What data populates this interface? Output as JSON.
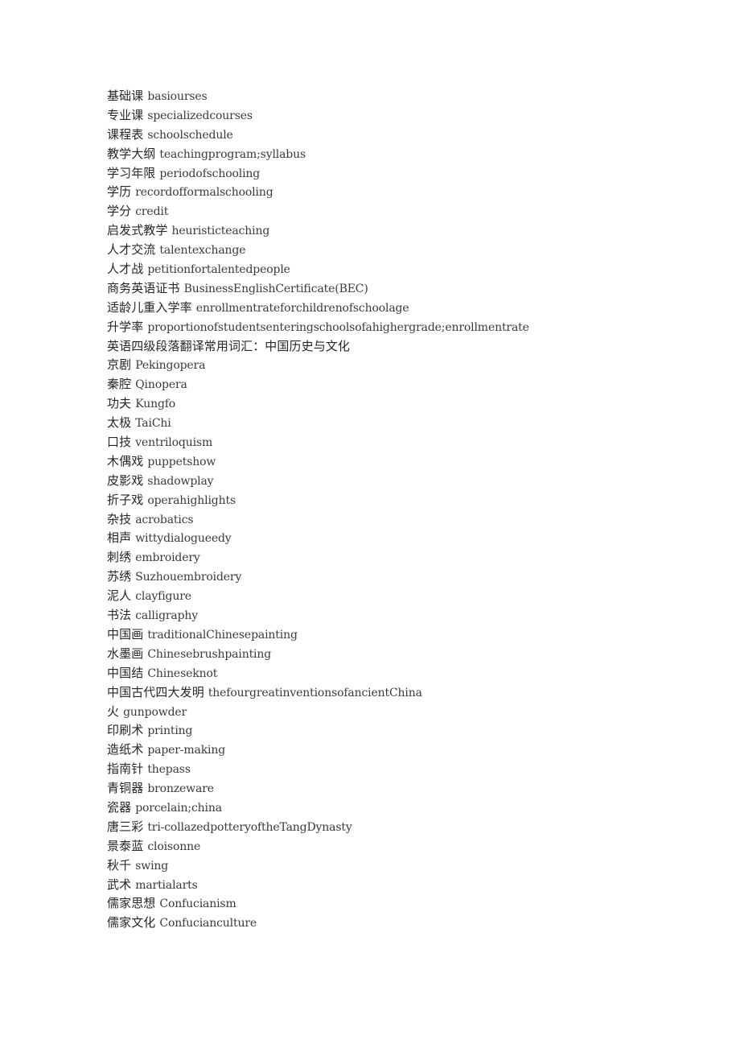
{
  "document": {
    "background_color": "#ffffff",
    "text_color": "#2b2b2b",
    "lines": [
      {
        "cn": "基础课",
        "en": "basiourses"
      },
      {
        "cn": "专业课",
        "en": "specializedcourses"
      },
      {
        "cn": "课程表",
        "en": "schoolschedule"
      },
      {
        "cn": "教学大纲",
        "en": "teachingprogram;syllabus"
      },
      {
        "cn": "学习年限",
        "en": "periodofschooling"
      },
      {
        "cn": "学历",
        "en": "recordofformalschooling"
      },
      {
        "cn": "学分",
        "en": "credit"
      },
      {
        "cn": "启发式教学",
        "en": "heuristicteaching"
      },
      {
        "cn": "人才交流",
        "en": "talentexchange"
      },
      {
        "cn": "人才战",
        "en": "petitionfortalentedpeople"
      },
      {
        "cn": "商务英语证书",
        "en": "BusinessEnglishCertificate(BEC)"
      },
      {
        "cn": "适龄儿重入学率",
        "en": "enrollmentrateforchildrenofschoolage"
      },
      {
        "cn": "升学率",
        "en": "proportionofstudentsenteringschoolsofahighergrade;enrollmentrate"
      },
      {
        "cn": "英语四级段落翻译常用词汇：中国历史与文化",
        "en": "",
        "heading": true
      },
      {
        "cn": "京剧",
        "en": "Pekingopera"
      },
      {
        "cn": "秦腔",
        "en": "Qinopera"
      },
      {
        "cn": "功夫",
        "en": "Kungfo"
      },
      {
        "cn": "太极",
        "en": "TaiChi"
      },
      {
        "cn": "口技",
        "en": "ventriloquism"
      },
      {
        "cn": "木偶戏",
        "en": "puppetshow"
      },
      {
        "cn": "皮影戏",
        "en": "shadowplay"
      },
      {
        "cn": "折子戏",
        "en": "operahighlights"
      },
      {
        "cn": "杂技",
        "en": "acrobatics"
      },
      {
        "cn": "相声",
        "en": "wittydialogueedy"
      },
      {
        "cn": "刺绣",
        "en": "embroidery"
      },
      {
        "cn": "苏绣",
        "en": "Suzhouembroidery"
      },
      {
        "cn": "泥人",
        "en": "clayfigure"
      },
      {
        "cn": "书法",
        "en": "calligraphy"
      },
      {
        "cn": "中国画",
        "en": "traditionalChinesepainting"
      },
      {
        "cn": "水墨画",
        "en": "Chinesebrushpainting"
      },
      {
        "cn": "中国结",
        "en": "Chineseknot"
      },
      {
        "cn": "中国古代四大发明",
        "en": "thefourgreatinventionsofancientChina"
      },
      {
        "cn": "火",
        "en": "gunpowder"
      },
      {
        "cn": "印刷术",
        "en": "printing"
      },
      {
        "cn": "造纸术",
        "en": "paper-making"
      },
      {
        "cn": "指南针",
        "en": "thepass"
      },
      {
        "cn": "青铜器",
        "en": "bronzeware"
      },
      {
        "cn": "瓷器",
        "en": "porcelain;china"
      },
      {
        "cn": "唐三彩",
        "en": "tri-collazedpotteryoftheTangDynasty"
      },
      {
        "cn": "景泰蓝",
        "en": "cloisonne"
      },
      {
        "cn": "秋千",
        "en": "swing"
      },
      {
        "cn": "武术",
        "en": "martialarts"
      },
      {
        "cn": "儒家思想",
        "en": "Confucianism"
      },
      {
        "cn": "儒家文化",
        "en": "Confucianculture"
      }
    ]
  }
}
